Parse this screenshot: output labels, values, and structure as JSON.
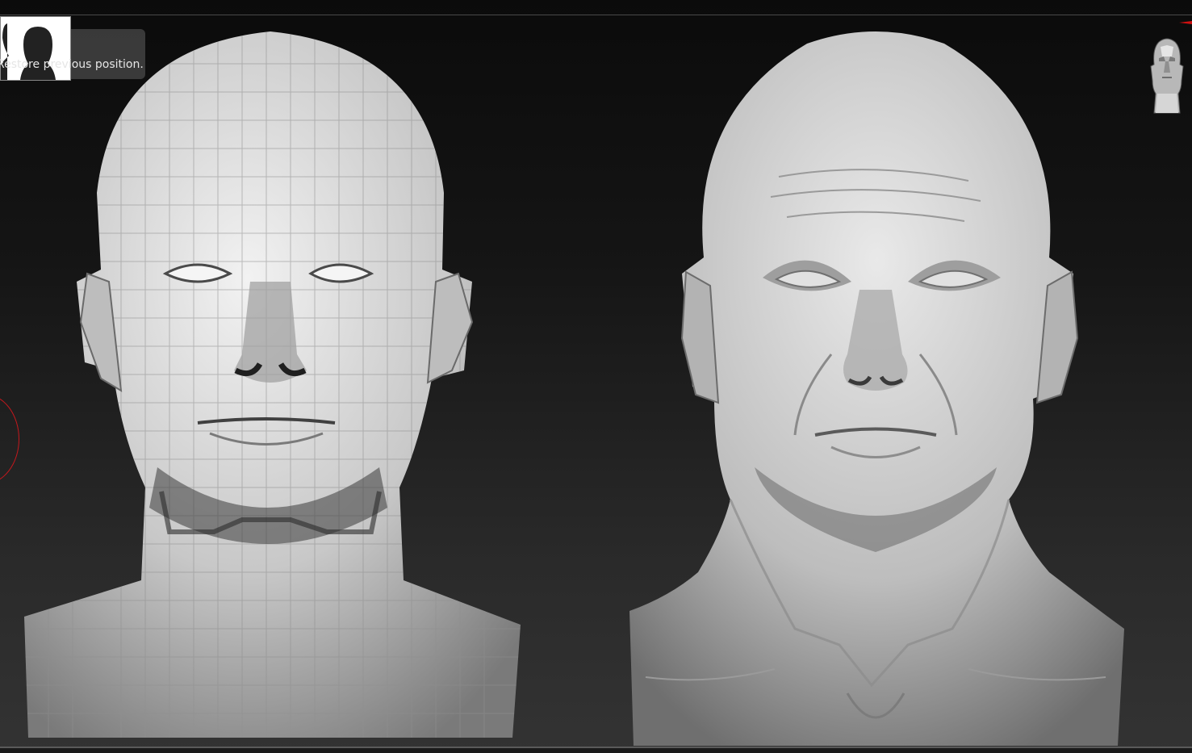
{
  "tooltip": {
    "text": "Restore previous position."
  },
  "icons": {
    "thumbnail": "head-thumbnail-icon",
    "navigation": "head-navigation-icon",
    "cursor": "brush-cursor-ring"
  },
  "colors": {
    "background_top": "#0b0b0b",
    "background_bottom": "#333333",
    "cursor_ring": "#c4181d",
    "tooltip_bg": "#3e3e3e",
    "tooltip_text": "#e6e6e6"
  }
}
